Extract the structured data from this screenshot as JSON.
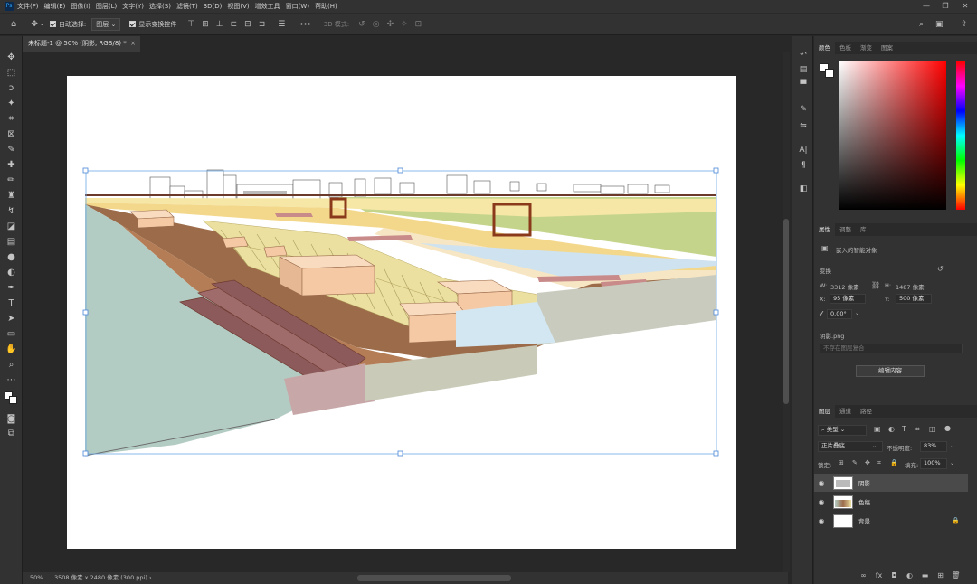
{
  "app": {
    "logo": "Ps"
  },
  "menu": [
    "文件(F)",
    "编辑(E)",
    "图像(I)",
    "图层(L)",
    "文字(Y)",
    "选择(S)",
    "滤镜(T)",
    "3D(D)",
    "视图(V)",
    "增效工具",
    "窗口(W)",
    "帮助(H)"
  ],
  "window_buttons": [
    "—",
    "❐",
    "✕"
  ],
  "options": {
    "auto_select_label": "自动选择:",
    "auto_select_target": "图层",
    "show_transform_label": "显示变换控件",
    "mode_3d_label": "3D 模式:",
    "more": "•••"
  },
  "document": {
    "tab_title": "未标题-1 @ 50% (阴影, RGB/8) *",
    "close": "×"
  },
  "status": {
    "zoom": "50%",
    "info": "3508 像素 x 2480 像素 (300 ppi)",
    "arrow": "›"
  },
  "color_panel": {
    "tabs": [
      "颜色",
      "色板",
      "渐变",
      "图案"
    ],
    "hue": "#ff0000"
  },
  "properties_panel": {
    "tabs": [
      "属性",
      "调整",
      "库"
    ],
    "type_label": "嵌入的智能对象",
    "transform_label": "变换",
    "w_label": "W:",
    "w_value": "3312 像素",
    "h_label": "H:",
    "h_value": "1487 像素",
    "x_label": "X:",
    "x_value": "95 像素",
    "y_label": "Y:",
    "y_value": "500 像素",
    "angle_value": "0.00°",
    "file_name": "阴影.png",
    "comp_placeholder": "不存在图层复合",
    "edit_button": "编辑内容"
  },
  "layers_panel": {
    "tabs": [
      "图层",
      "通道",
      "路径"
    ],
    "filter_kind": "类型",
    "blend_mode": "正片叠底",
    "opacity_label": "不透明度:",
    "opacity_value": "83%",
    "lock_label": "锁定:",
    "fill_label": "填充:",
    "fill_value": "100%",
    "layers": [
      {
        "name": "阴影",
        "selected": true
      },
      {
        "name": "色稿",
        "selected": false
      },
      {
        "name": "背景",
        "selected": false,
        "locked": true
      }
    ],
    "bottom_icons": [
      "link-icon",
      "fx-icon",
      "mask-icon",
      "adjustment-icon",
      "group-icon",
      "new-layer-icon",
      "trash-icon"
    ]
  }
}
